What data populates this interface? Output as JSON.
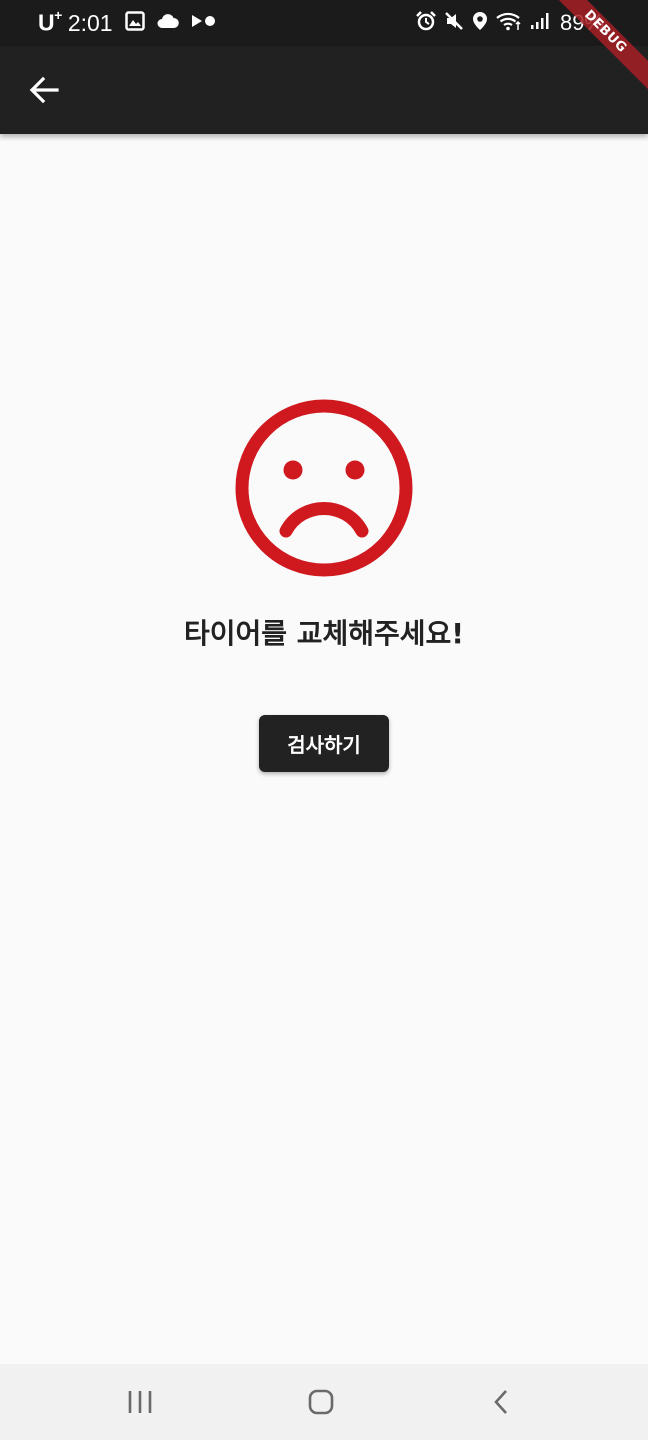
{
  "status_bar": {
    "carrier": "U",
    "carrier_sup": "+",
    "time": "2:01",
    "left_icons": [
      "image-icon",
      "cloud-icon",
      "media-icon"
    ],
    "right_icons": [
      "alarm-icon",
      "mute-icon",
      "location-icon",
      "wifi-icon",
      "signal-icon"
    ],
    "battery": "89%"
  },
  "debug_banner": "DEBUG",
  "app_bar": {
    "back_icon": "arrow-back-icon"
  },
  "main": {
    "face_icon": "sad-face-icon",
    "face_color": "#d0181f",
    "message": "타이어를 교체해주세요!",
    "button_label": "검사하기"
  },
  "nav_bar": {
    "icons": [
      "recents-icon",
      "home-icon",
      "back-icon"
    ]
  }
}
